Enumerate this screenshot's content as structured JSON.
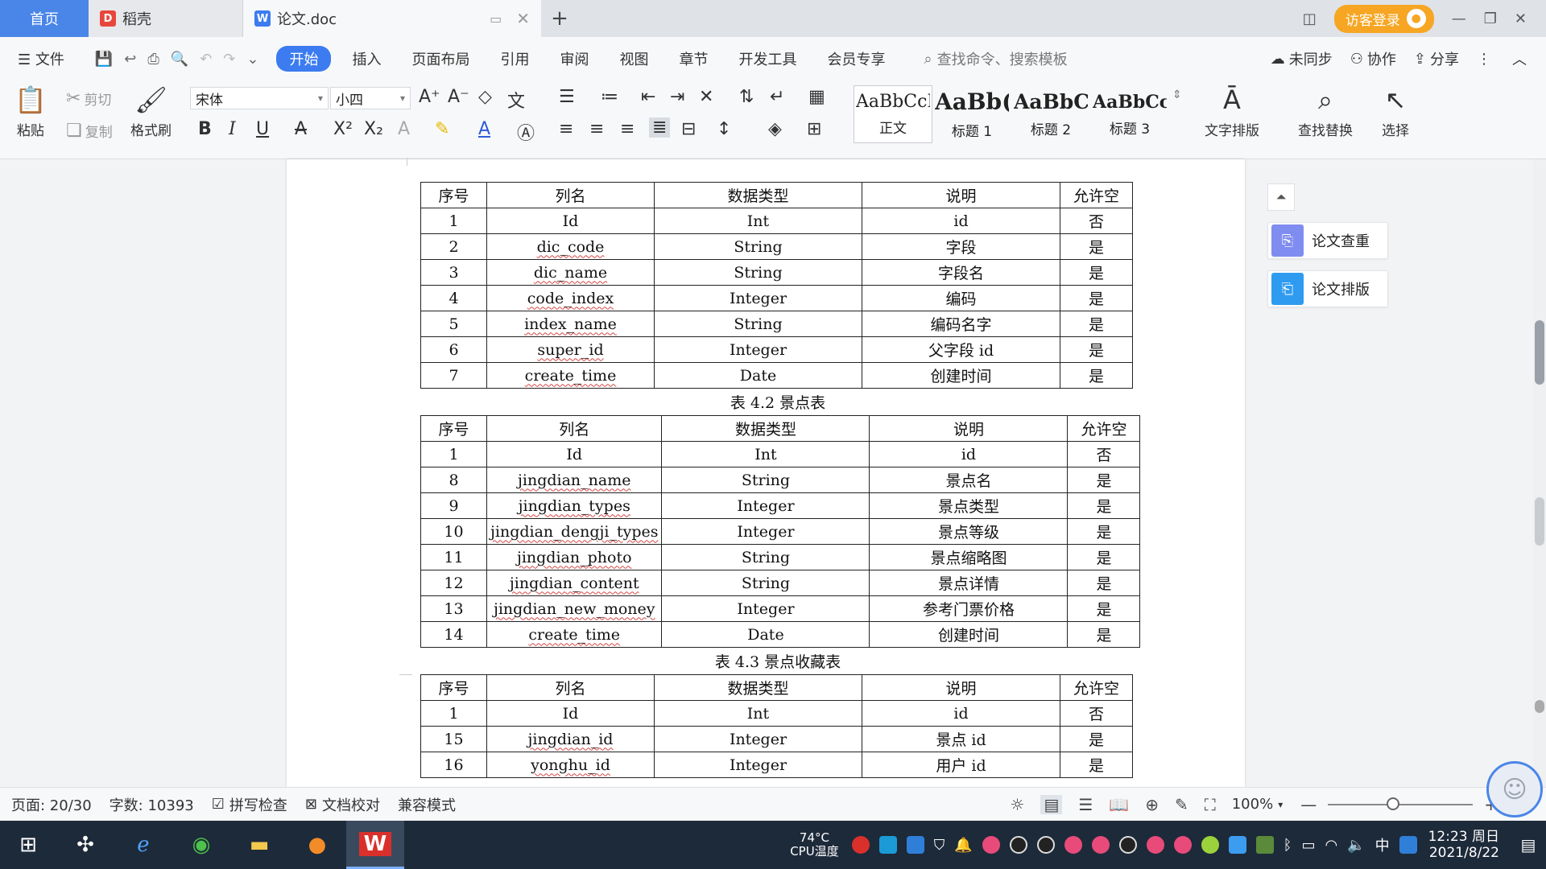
{
  "tabs": {
    "home": "首页",
    "daoke": "稻壳",
    "doc": "论文.doc"
  },
  "titlebar": {
    "login": "访客登录"
  },
  "menu": {
    "file": "文件",
    "items": [
      "开始",
      "插入",
      "页面布局",
      "引用",
      "审阅",
      "视图",
      "章节",
      "开发工具",
      "会员专享"
    ],
    "search_placeholder": "查找命令、搜索模板",
    "sync": "未同步",
    "collab": "协作",
    "share": "分享"
  },
  "ribbon": {
    "paste": "粘贴",
    "cut": "剪切",
    "copy": "复制",
    "format_painter": "格式刷",
    "font_name": "宋体",
    "font_size": "小四",
    "styles": [
      {
        "preview": "AaBbCcI",
        "label": "正文"
      },
      {
        "preview": "AaBb(",
        "label": "标题 1"
      },
      {
        "preview": "AaBbC",
        "label": "标题 2"
      },
      {
        "preview": "AaBbCcl",
        "label": "标题 3"
      }
    ],
    "text_layout": "文字排版",
    "find_replace": "查找替换",
    "select": "选择"
  },
  "tables": [
    {
      "caption": "",
      "header": [
        "序号",
        "列名",
        "数据类型",
        "说明",
        "允许空"
      ],
      "rows": [
        [
          "1",
          "Id",
          "Int",
          "id",
          "否"
        ],
        [
          "2",
          "dic_code",
          "String",
          "字段",
          "是"
        ],
        [
          "3",
          "dic_name",
          "String",
          "字段名",
          "是"
        ],
        [
          "4",
          "code_index",
          "Integer",
          "编码",
          "是"
        ],
        [
          "5",
          "index_name",
          "String",
          "编码名字",
          "是"
        ],
        [
          "6",
          "super_id",
          "Integer",
          "父字段 id",
          "是"
        ],
        [
          "7",
          "create_time",
          "Date",
          "创建时间",
          "是"
        ]
      ]
    },
    {
      "caption": "表 4.2 景点表",
      "header": [
        "序号",
        "列名",
        "数据类型",
        "说明",
        "允许空"
      ],
      "rows": [
        [
          "1",
          "Id",
          "Int",
          "id",
          "否"
        ],
        [
          "8",
          "jingdian_name",
          "String",
          "景点名",
          "是"
        ],
        [
          "9",
          "jingdian_types",
          "Integer",
          "景点类型",
          "是"
        ],
        [
          "10",
          "jingdian_dengji_types",
          "Integer",
          "景点等级",
          "是"
        ],
        [
          "11",
          "jingdian_photo",
          "String",
          "景点缩略图",
          "是"
        ],
        [
          "12",
          "jingdian_content",
          "String",
          "景点详情",
          "是"
        ],
        [
          "13",
          "jingdian_new_money",
          "Integer",
          "参考门票价格",
          "是"
        ],
        [
          "14",
          "create_time",
          "Date",
          "创建时间",
          "是"
        ]
      ]
    },
    {
      "caption": "表 4.3 景点收藏表",
      "header": [
        "序号",
        "列名",
        "数据类型",
        "说明",
        "允许空"
      ],
      "rows": [
        [
          "1",
          "Id",
          "Int",
          "id",
          "否"
        ],
        [
          "15",
          "jingdian_id",
          "Integer",
          "景点 id",
          "是"
        ],
        [
          "16",
          "yonghu_id",
          "Integer",
          "用户 id",
          "是"
        ]
      ]
    }
  ],
  "side_panel": {
    "check": "论文查重",
    "layout": "论文排版"
  },
  "status": {
    "page": "页面: 20/30",
    "words": "字数: 10393",
    "spell": "拼写检查",
    "proof": "文档校对",
    "compat": "兼容模式",
    "zoom": "100%",
    "zoom_level": 0.45
  },
  "taskbar": {
    "cpu_temp": "74°C",
    "cpu_label": "CPU温度",
    "ime": "中",
    "time": "12:23 周日",
    "date": "2021/8/22"
  },
  "colors": {
    "accent": "#3c7cf0",
    "login": "#f6a623",
    "home_tab": "#4a86e8",
    "wps_red": "#d9302c"
  }
}
